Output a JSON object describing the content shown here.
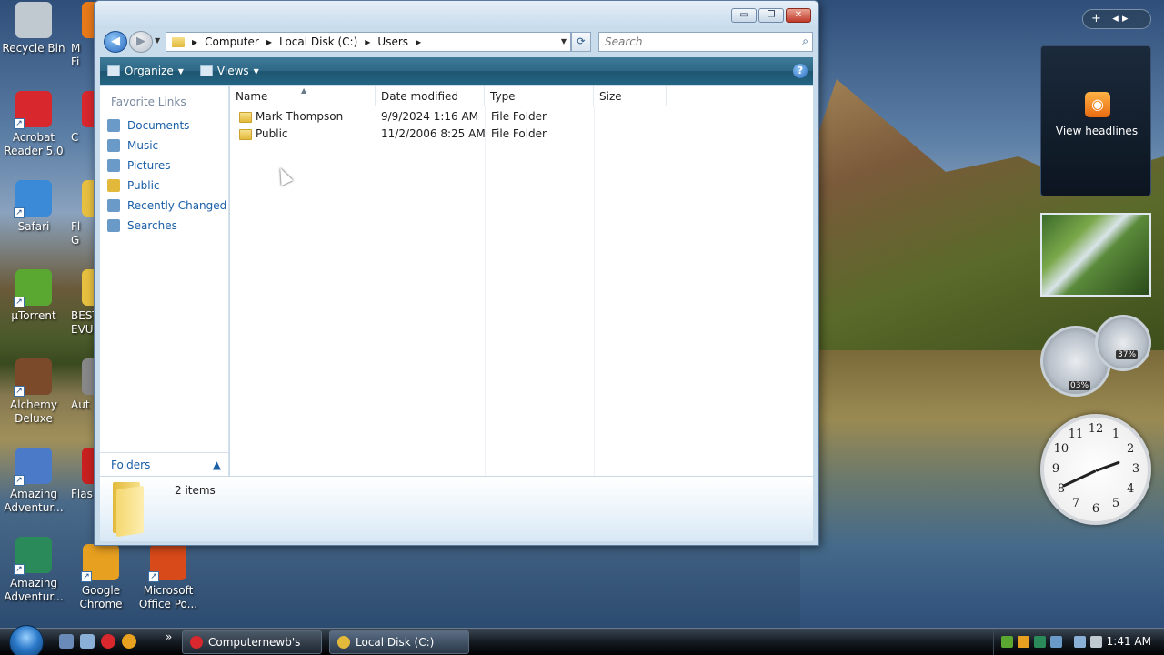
{
  "desktop": {
    "icons_col1": [
      {
        "label": "Recycle Bin",
        "color": "#c0c8d0"
      },
      {
        "label": "Acrobat Reader 5.0",
        "color": "#d8272d"
      },
      {
        "label": "Safari",
        "color": "#3a8ad8"
      },
      {
        "label": "µTorrent",
        "color": "#5aa832"
      },
      {
        "label": "Alchemy Deluxe",
        "color": "#7a4a2a"
      },
      {
        "label": "Amazing Adventur...",
        "color": "#4a7ac8"
      },
      {
        "label": "Amazing Adventur...",
        "color": "#2a8a5a"
      }
    ],
    "icons_col2_partial": [
      {
        "label": "M\nFi",
        "color": "#e87a1a"
      },
      {
        "label": "C",
        "color": "#d8272d"
      },
      {
        "label": "Fl\nG",
        "color": "#e8c040"
      },
      {
        "label": "BEST\nEVU",
        "color": "#e8c040"
      },
      {
        "label": "Aut",
        "color": "#888"
      },
      {
        "label": "Flas",
        "color": "#c82020"
      }
    ],
    "icons_bottom": [
      {
        "label": "Google Chrome",
        "color": "#e8a020"
      },
      {
        "label": "Microsoft Office Po...",
        "color": "#d84a1a"
      }
    ]
  },
  "window": {
    "controls": {
      "minimize": "▭",
      "maximize": "❐",
      "close": "✕"
    },
    "breadcrumb": [
      "Computer",
      "Local Disk (C:)",
      "Users"
    ],
    "search_placeholder": "Search",
    "toolbar": {
      "organize": "Organize",
      "views": "Views",
      "help": "?"
    },
    "favorite_links_header": "Favorite Links",
    "favorite_links": [
      {
        "label": "Documents",
        "color": "#6a9ac8"
      },
      {
        "label": "Music",
        "color": "#6a9ac8"
      },
      {
        "label": "Pictures",
        "color": "#6a9ac8"
      },
      {
        "label": "Public",
        "color": "#e2b93a"
      },
      {
        "label": "Recently Changed",
        "color": "#6a9ac8"
      },
      {
        "label": "Searches",
        "color": "#6a9ac8"
      }
    ],
    "folders_label": "Folders",
    "columns": [
      "Name",
      "Date modified",
      "Type",
      "Size"
    ],
    "rows": [
      {
        "name": "Mark Thompson",
        "date": "9/9/2024 1:16 AM",
        "type": "File Folder",
        "size": ""
      },
      {
        "name": "Public",
        "date": "11/2/2006 8:25 AM",
        "type": "File Folder",
        "size": ""
      }
    ],
    "item_count": "2 items"
  },
  "gadgets": {
    "sidebar_add": "+",
    "rss_label": "View headlines",
    "cpu_percent": "03%",
    "mem_percent": "37%",
    "clock_numbers": [
      "12",
      "1",
      "2",
      "3",
      "4",
      "5",
      "6",
      "7",
      "8",
      "9",
      "10",
      "11"
    ]
  },
  "taskbar": {
    "tasks": [
      {
        "label": "Computernewb's In...",
        "color": "#d8272d"
      },
      {
        "label": "Local Disk (C:)",
        "color": "#e2b93a"
      }
    ],
    "overflow": "»",
    "clock": "1:41 AM"
  }
}
